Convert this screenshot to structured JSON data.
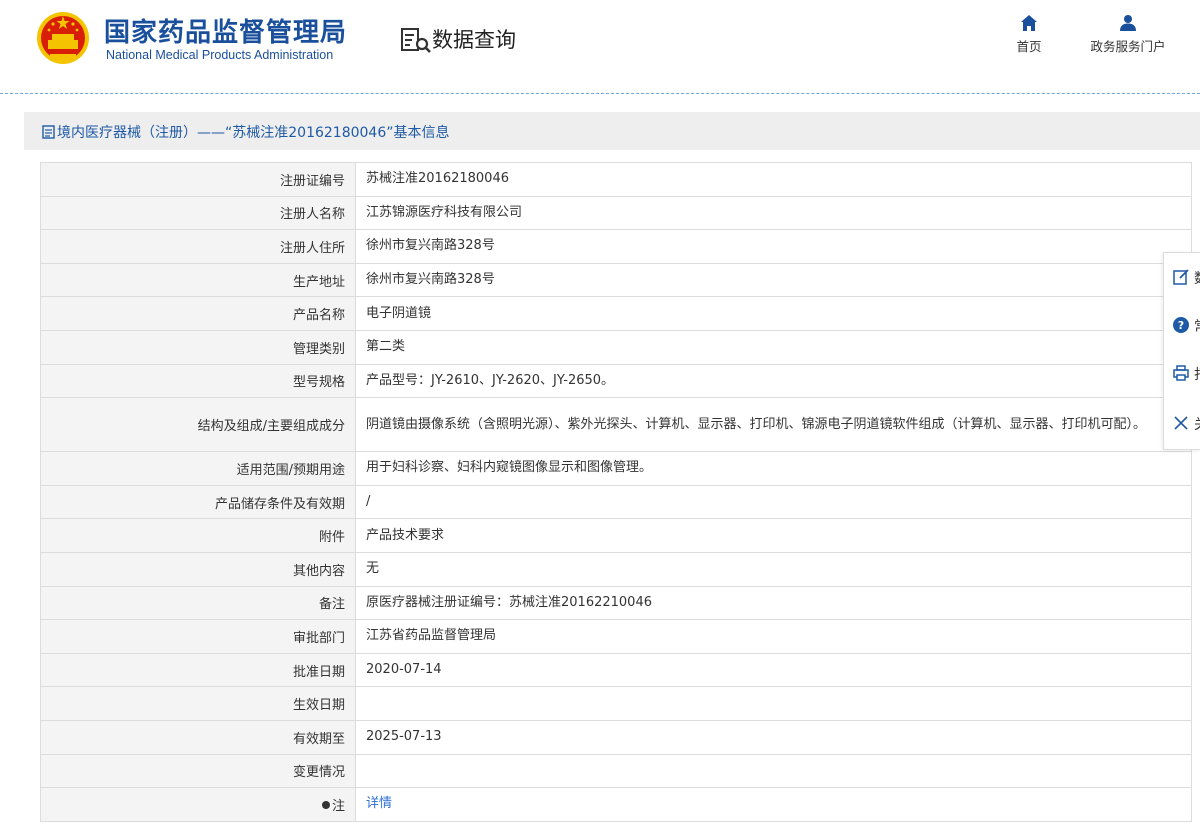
{
  "header": {
    "brand_cn": "国家药品监督管理局",
    "brand_en": "National Medical Products Administration",
    "section_title": "数据查询",
    "nav": [
      {
        "label": "首页",
        "icon": "home-icon"
      },
      {
        "label": "政务服务门户",
        "icon": "user-icon"
      }
    ]
  },
  "title_bar": {
    "text": "境内医疗器械（注册）——“苏械注准20162180046”基本信息"
  },
  "rows": [
    {
      "label": "注册证编号",
      "value": "苏械注准20162180046"
    },
    {
      "label": "注册人名称",
      "value": "江苏锦源医疗科技有限公司"
    },
    {
      "label": "注册人住所",
      "value": "徐州市复兴南路328号"
    },
    {
      "label": "生产地址",
      "value": "徐州市复兴南路328号"
    },
    {
      "label": "产品名称",
      "value": "电子阴道镜"
    },
    {
      "label": "管理类别",
      "value": "第二类"
    },
    {
      "label": "型号规格",
      "value": "产品型号：JY-2610、JY-2620、JY-2650。"
    },
    {
      "label": "结构及组成/主要组成成分",
      "value": "阴道镜由摄像系统（含照明光源）、紫外光探头、计算机、显示器、打印机、锦源电子阴道镜软件组成（计算机、显示器、打印机可配）。"
    },
    {
      "label": "适用范围/预期用途",
      "value": "用于妇科诊察、妇科内窥镜图像显示和图像管理。"
    },
    {
      "label": "产品储存条件及有效期",
      "value": "/"
    },
    {
      "label": "附件",
      "value": "产品技术要求"
    },
    {
      "label": "其他内容",
      "value": "无"
    },
    {
      "label": "备注",
      "value": "原医疗器械注册证编号：苏械注准20162210046"
    },
    {
      "label": "审批部门",
      "value": "江苏省药品监督管理局"
    },
    {
      "label": "批准日期",
      "value": "2020-07-14"
    },
    {
      "label": "生效日期",
      "value": ""
    },
    {
      "label": "有效期至",
      "value": "2025-07-13"
    },
    {
      "label": "变更情况",
      "value": ""
    },
    {
      "label": "注",
      "value": "详情"
    }
  ],
  "side_tools": [
    {
      "icon": "edit-icon",
      "label": "数"
    },
    {
      "icon": "help-icon",
      "label": "常"
    },
    {
      "icon": "print-icon",
      "label": "打"
    },
    {
      "icon": "close-icon",
      "label": "关"
    }
  ],
  "colors": {
    "brand_blue": "#1a4f9c",
    "link_blue": "#2e6fd4",
    "emblem_red": "#d81e06",
    "emblem_gold": "#f5c400"
  }
}
